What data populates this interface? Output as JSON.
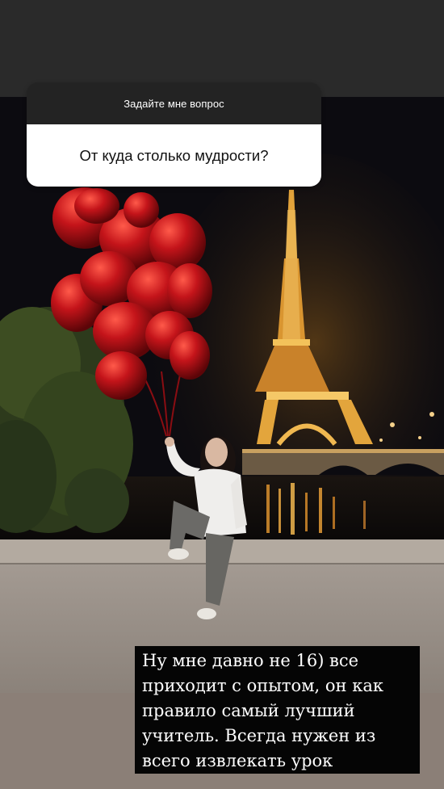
{
  "story": {
    "question_sticker": {
      "prompt": "Задайте мне вопрос",
      "question": "От куда столько мудрости?"
    },
    "answer_text": "Ну мне давно не 16) все\nприходит с опытом, он как\nправило самый лучший\nучитель. Всегда нужен из\nвсего извлекать урок"
  },
  "colors": {
    "top_bar": "#2a2a2a",
    "sticker_header": "#232323",
    "sticker_body": "#ffffff",
    "caption_background": "#050505",
    "bottom_bar": "#8b7f77"
  }
}
